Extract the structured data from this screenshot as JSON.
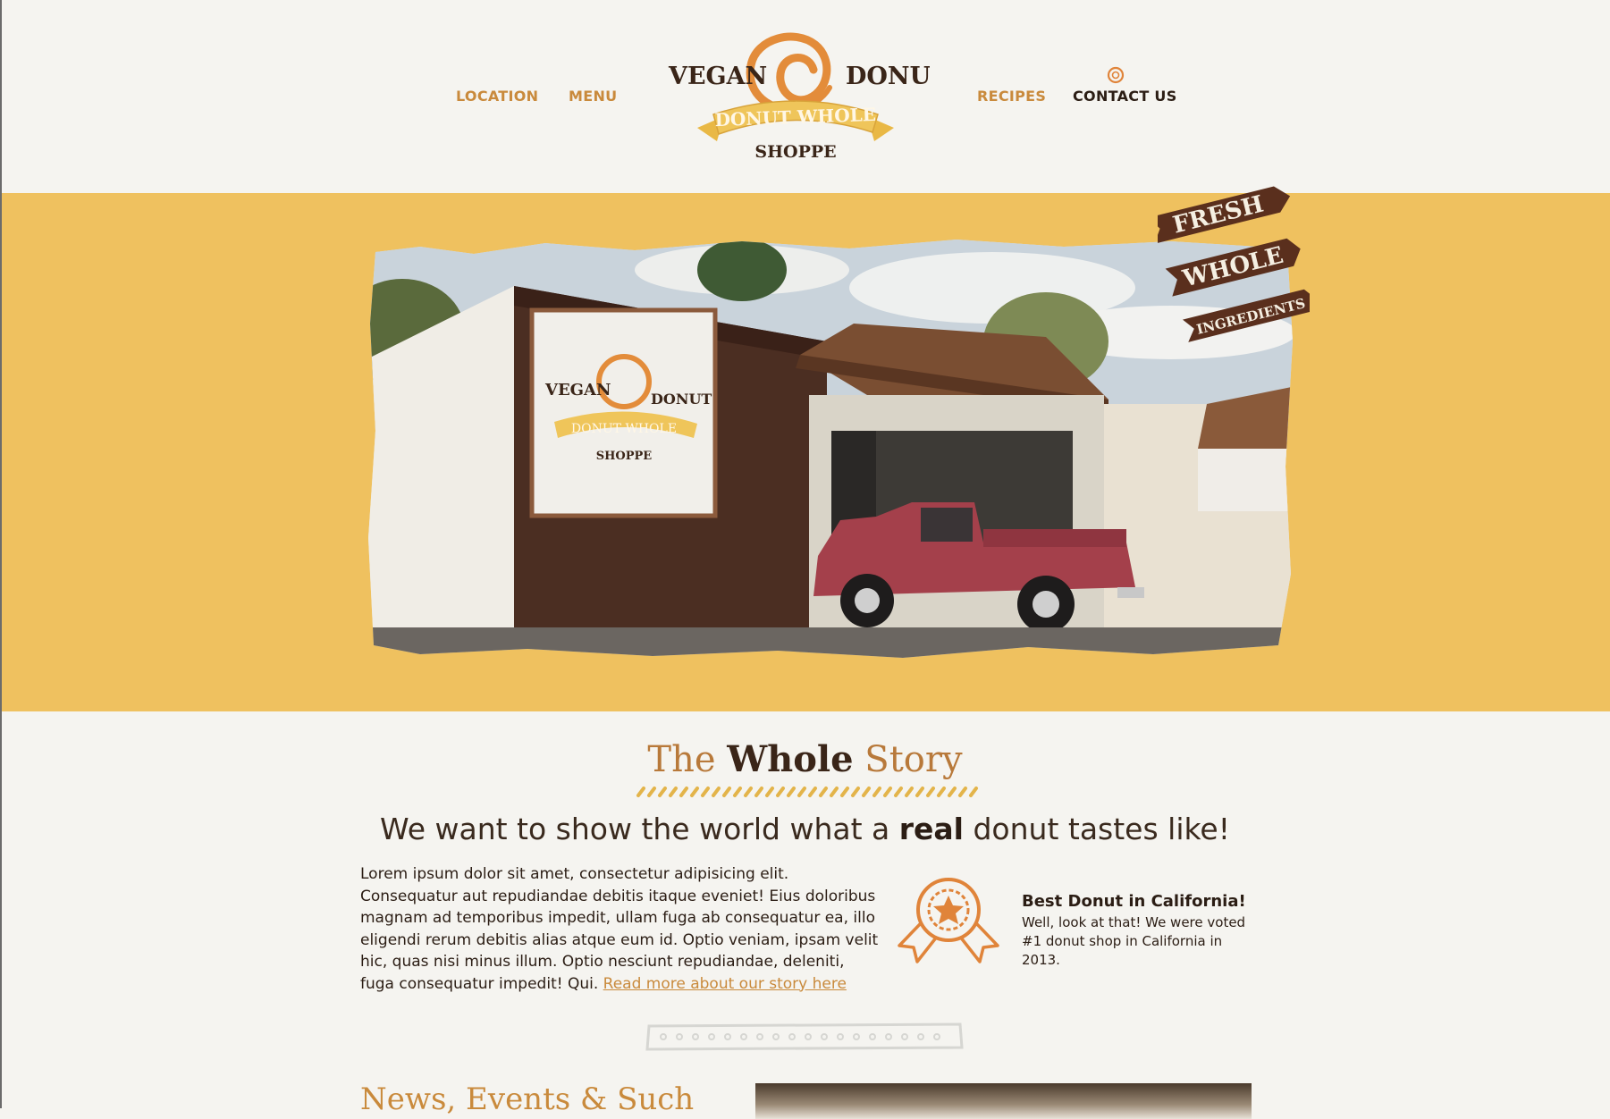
{
  "header": {
    "nav_left": [
      {
        "label": "LOCATION"
      },
      {
        "label": "MENU"
      }
    ],
    "nav_right": [
      {
        "label": "RECIPES"
      },
      {
        "label": "CONTACT US"
      }
    ],
    "logo": {
      "word_left": "VEGAN",
      "word_right": "DONUT",
      "ribbon": "DONUT WHOLE",
      "bottom": "SHOPPE"
    }
  },
  "hero": {
    "badge": [
      "FRESH",
      "WHOLE",
      "INGREDIENTS"
    ],
    "photo_sign": {
      "word_left": "VEGAN",
      "word_right": "DONUT",
      "ribbon": "DONUT WHOLE",
      "bottom": "SHOPPE"
    }
  },
  "story": {
    "title_part1": "The",
    "title_part2": "Whole",
    "title_part3": "Story",
    "tagline_before": "We want to show the world what a",
    "tagline_bold": "real",
    "tagline_after": "donut tastes like!",
    "body": "Lorem ipsum dolor sit amet, consectetur adipisicing elit. Consequatur aut repudiandae debitis itaque eveniet! Eius doloribus magnam ad temporibus impedit, ullam fuga ab consequatur ea, illo eligendi rerum debitis alias atque eum id. Optio veniam, ipsam velit hic, quas nisi minus illum. Optio nesciunt repudiandae, deleniti, fuga consequatur impedit! Qui.",
    "read_more": "Read more about our story here",
    "award_title": "Best Donut in California!",
    "award_desc": "Well, look at that! We were voted #1 donut shop in California in 2013."
  },
  "news": {
    "title": "News, Events & Such"
  },
  "colors": {
    "accent_orange": "#c98a3c",
    "hero_yellow": "#efc15f",
    "dark_brown": "#3a2518",
    "background": "#f5f4f0"
  }
}
